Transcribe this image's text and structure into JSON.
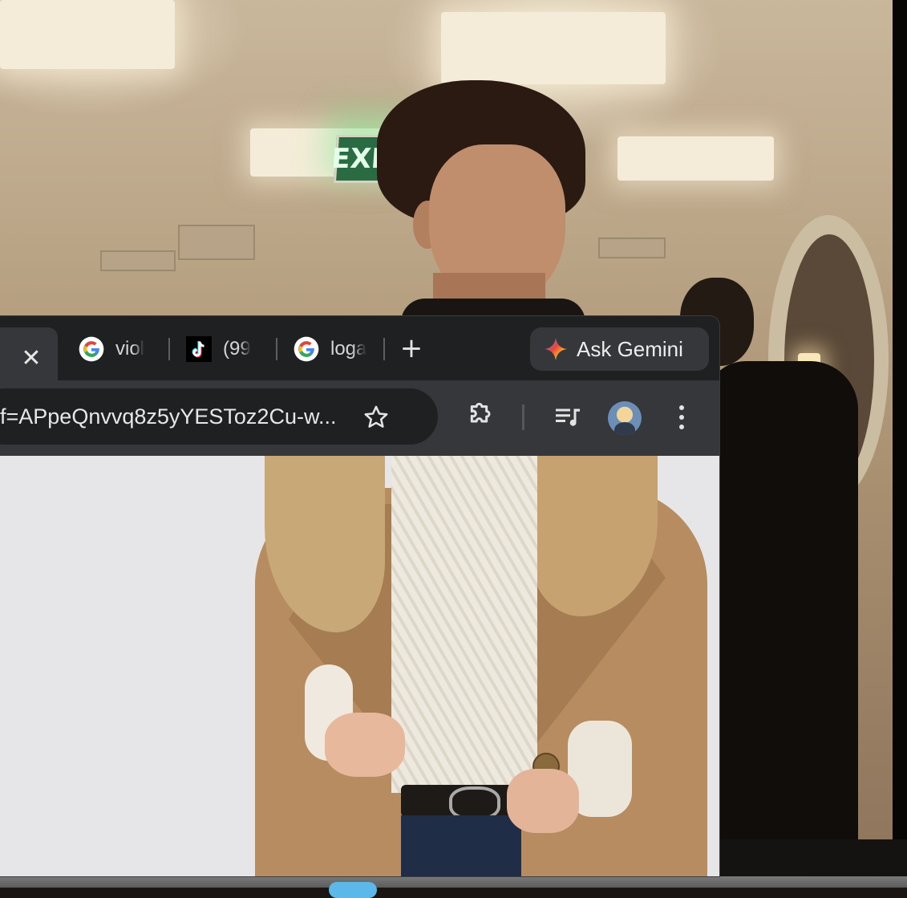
{
  "background": {
    "exit_sign_text": "EXIT"
  },
  "browser": {
    "tabs": [
      {
        "title": "viol",
        "favicon": "google-icon"
      },
      {
        "title": "(99",
        "favicon": "tiktok-icon"
      },
      {
        "title": "loga",
        "favicon": "google-icon"
      }
    ],
    "close_symbol": "✕",
    "new_tab_symbol": "+",
    "gemini_label": "Ask Gemini",
    "address_text": "f=APpeQnvvq8z5yYESToz2Cu-w...",
    "colors": {
      "frame": "#1f2022",
      "toolbar": "#36373a",
      "page_bg": "#e6e6e8"
    }
  },
  "icons": {
    "bookmark": "star-icon",
    "extensions": "puzzle-icon",
    "media": "media-playlist-icon",
    "profile": "avatar",
    "menu": "kebab-menu-icon"
  }
}
